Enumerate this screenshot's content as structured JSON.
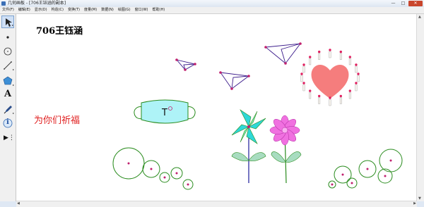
{
  "window": {
    "title": "几何画板 - [706王钰涵的副本]",
    "buttons": [
      "—",
      "□",
      "✕"
    ]
  },
  "menu": {
    "items": [
      "文件(F)",
      "编辑(E)",
      "显示(D)",
      "构造(C)",
      "变换(T)",
      "度量(M)",
      "数据(N)",
      "绘图(G)",
      "窗口(W)",
      "帮助(H)"
    ]
  },
  "tools": [
    {
      "name": "arrow-select-tool-icon",
      "selected": true
    },
    {
      "name": "point-tool-icon"
    },
    {
      "name": "compass-tool-icon"
    },
    {
      "name": "straightedge-tool-icon"
    },
    {
      "name": "polygon-tool-icon"
    },
    {
      "name": "text-tool-icon",
      "glyph": "A"
    },
    {
      "name": "marker-tool-icon"
    },
    {
      "name": "information-tool-icon",
      "glyph": "i"
    },
    {
      "name": "custom-tool-icon",
      "glyph": "▶⋮"
    }
  ],
  "canvas": {
    "author_label": "706王钰涵",
    "blessing_text": "为你们祈福",
    "mask_glyph": "T",
    "colors": {
      "blessing": "#e02020",
      "point": "#c0206e",
      "circle": "#2a8c1e",
      "heart": "#f57d7d",
      "mask": "#aef3f7",
      "flower": "#f070e0",
      "leaf": "#a8dcc0",
      "plane": "#3a1a8a"
    }
  }
}
